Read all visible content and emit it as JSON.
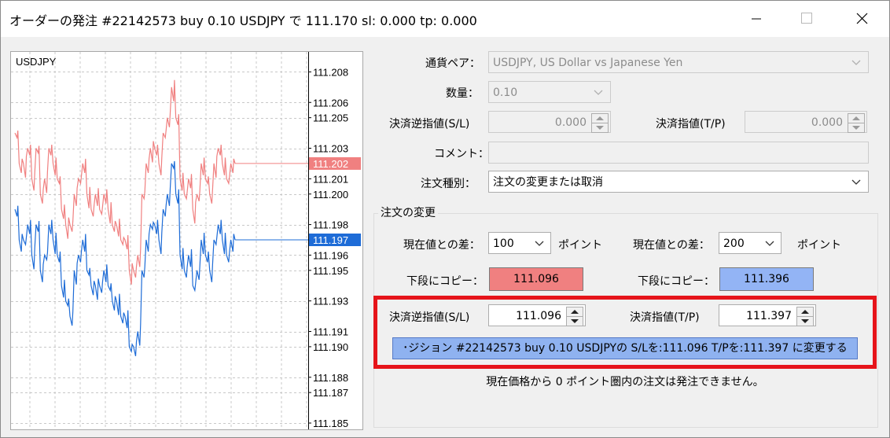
{
  "window": {
    "title": "オーダーの発注 #22142573 buy 0.10 USDJPY で 111.170 sl: 0.000 tp: 0.000",
    "controls": [
      "minimize",
      "maximize",
      "close"
    ]
  },
  "chart": {
    "symbol": "USDJPY",
    "price_labels": [
      "111.208",
      "111.206",
      "111.205",
      "111.203",
      "111.201",
      "111.200",
      "111.198",
      "111.196",
      "111.195",
      "111.193",
      "111.191",
      "111.190",
      "111.188",
      "111.187",
      "111.185"
    ],
    "ask_price": "111.202",
    "bid_price": "111.197",
    "ask_color": "#f08080",
    "bid_color": "#1e6cd7",
    "grid": true
  },
  "chart_data": {
    "type": "line",
    "title": "USDJPY",
    "yticks": [
      111.208,
      111.206,
      111.205,
      111.203,
      111.201,
      111.2,
      111.198,
      111.196,
      111.195,
      111.193,
      111.191,
      111.19,
      111.188,
      111.187,
      111.185
    ],
    "ylim": [
      111.185,
      111.209
    ],
    "grid": true,
    "series": [
      {
        "values": [
          111.204,
          111.202,
          111.202,
          111.203,
          111.201,
          111.203,
          111.2,
          111.201,
          111.203,
          111.202,
          111.201,
          111.199,
          111.198,
          111.198,
          111.2,
          111.201,
          111.202,
          111.2,
          111.199,
          111.2,
          111.199,
          111.2,
          111.199,
          111.198,
          111.198,
          111.197,
          111.197,
          111.195,
          111.195,
          111.196,
          111.2,
          111.202,
          111.203,
          111.203,
          111.202,
          111.204,
          111.205,
          111.207,
          111.205,
          111.201,
          111.2,
          111.201,
          111.199,
          111.2,
          111.202,
          111.201,
          111.2,
          111.202,
          111.203,
          111.202,
          111.201,
          111.202,
          111.202
        ]
      },
      {
        "values": [
          111.199,
          111.197,
          111.197,
          111.198,
          111.196,
          111.198,
          111.195,
          111.196,
          111.198,
          111.197,
          111.196,
          111.194,
          111.193,
          111.192,
          111.195,
          111.196,
          111.197,
          111.195,
          111.194,
          111.194,
          111.194,
          111.195,
          111.194,
          111.193,
          111.193,
          111.192,
          111.192,
          111.19,
          111.19,
          111.191,
          111.195,
          111.197,
          111.198,
          111.198,
          111.197,
          111.199,
          111.2,
          111.202,
          111.2,
          111.196,
          111.195,
          111.196,
          111.194,
          111.195,
          111.197,
          111.196,
          111.195,
          111.197,
          111.198,
          111.197,
          111.196,
          111.197,
          111.197
        ]
      }
    ]
  },
  "form": {
    "symbol_label": "通貨ペア：",
    "symbol_value": "USDJPY, US Dollar vs Japanese Yen",
    "volume_label": "数量：",
    "volume_value": "0.10",
    "sl_label": "決済逆指値(S/L)",
    "sl_value": "0.000",
    "tp_label": "決済指値(T/P)",
    "tp_value": "0.000",
    "comment_label": "コメント：",
    "comment_value": "",
    "type_label": "注文種別：",
    "type_value": "注文の変更または取消"
  },
  "modify": {
    "group_label": "注文の変更",
    "diff_label_left": "現在値との差：",
    "diff_value_left": "100",
    "points_left": "ポイント",
    "diff_label_right": "現在値との差：",
    "diff_value_right": "200",
    "points_right": "ポイント",
    "copy_label_left": "下段にコピー：",
    "copy_value_left": "111.096",
    "copy_label_right": "下段にコピー：",
    "copy_value_right": "111.396",
    "copy_color_left": "#f08080",
    "copy_color_right": "#93b4f5",
    "sl_label": "決済逆指値(S/L)",
    "sl_value": "111.096",
    "tp_label": "決済指値(T/P)",
    "tp_value": "111.397",
    "modify_button": "･ジション #22142573 buy 0.10 USDJPYの S/Lを:111.096 T/Pを:111.397 に変更する",
    "note": "現在価格から 0 ポイント圏内の注文は発注できません。"
  }
}
